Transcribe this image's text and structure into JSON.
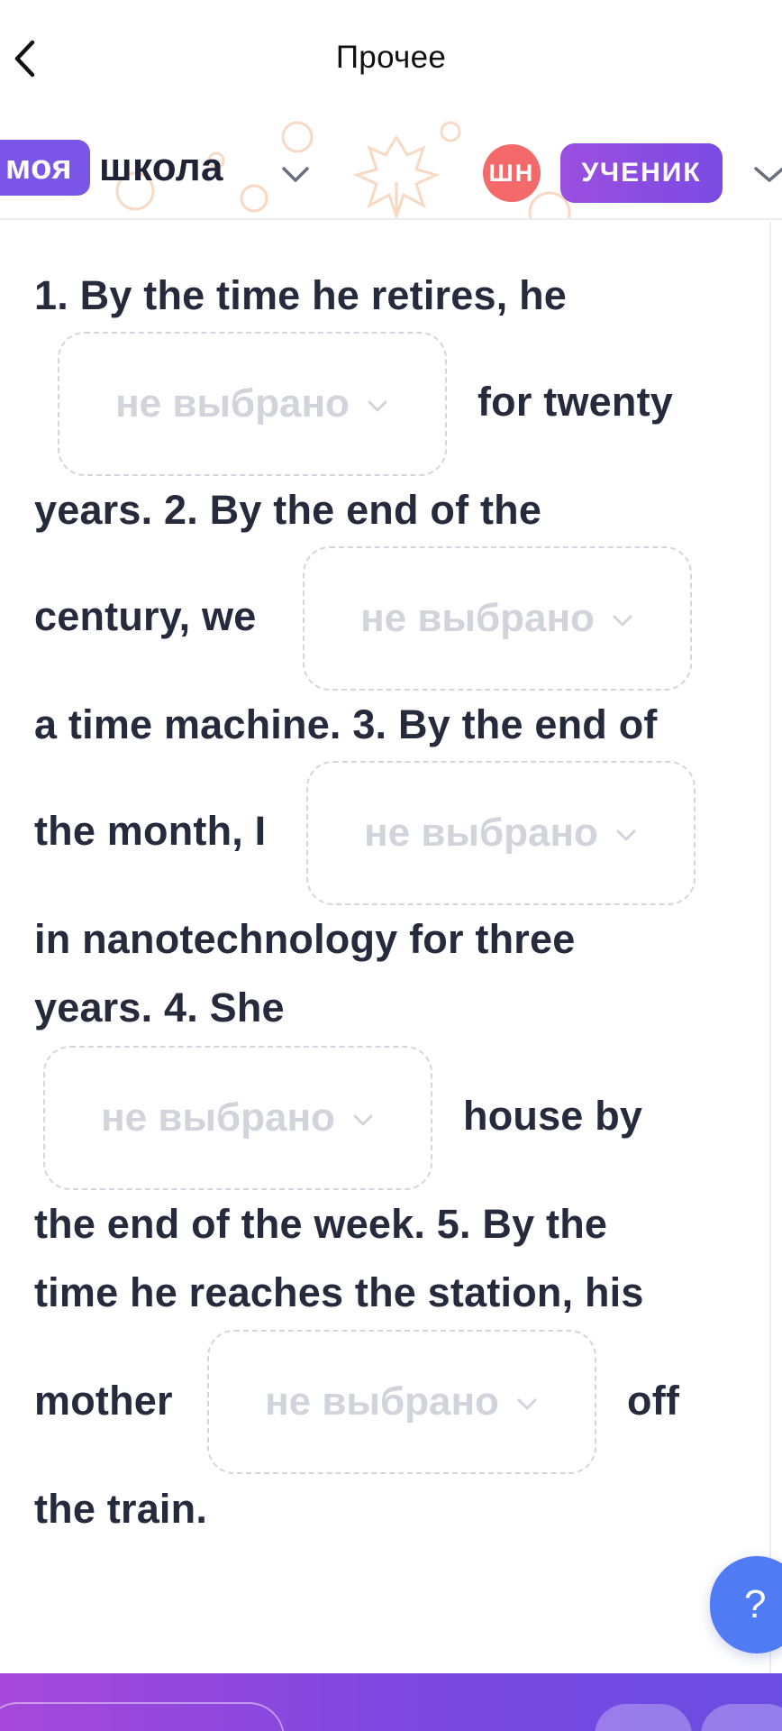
{
  "nav": {
    "title": "Прочее"
  },
  "header": {
    "brand_tag": "моя",
    "brand_word": "школа",
    "avatar_initials": "ШН",
    "role": "УЧЕНИК"
  },
  "exercise": {
    "line1": "1. By the time he retires, he",
    "line2_after": "for twenty",
    "line3": "years. 2. By the end of the",
    "line4_before": "century, we",
    "line5": "a time machine. 3. By the end of",
    "line6_before": "the month, I",
    "line7": "in nanotechnology for three",
    "line8": "years. 4. She",
    "line9_after": "house by",
    "line10": "the end of the week. 5. By the",
    "line11": "time he reaches the station, his",
    "line12_before": "mother",
    "line12_after": "off",
    "line13": "the train.",
    "dropdowns": [
      {
        "value": "не выбрано"
      },
      {
        "value": "не выбрано"
      },
      {
        "value": "не выбрано"
      },
      {
        "value": "не выбрано"
      },
      {
        "value": "не выбрано"
      }
    ]
  },
  "help": {
    "label": "?"
  },
  "colors": {
    "accent": "#7b55e8",
    "avatar": "#f46a6a",
    "help": "#4f7cf4",
    "text": "#262a3d",
    "placeholder": "#d2d4dc"
  },
  "icons": [
    "back-arrow-icon",
    "chevron-down-icon",
    "help-icon"
  ]
}
